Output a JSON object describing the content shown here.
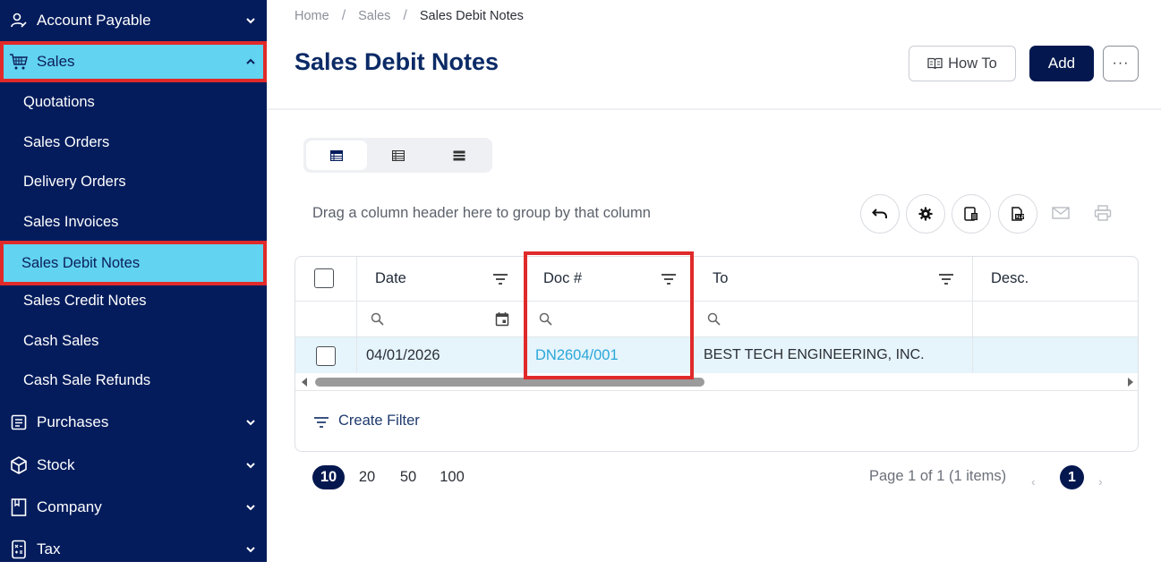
{
  "sidebar": {
    "groups": [
      {
        "label": "Account Payable",
        "icon": "user-edit-icon"
      },
      {
        "label": "Sales",
        "icon": "cart-icon"
      },
      {
        "label": "Purchases",
        "icon": "clipboard-icon"
      },
      {
        "label": "Stock",
        "icon": "cube-icon"
      },
      {
        "label": "Company",
        "icon": "bookmark-icon"
      },
      {
        "label": "Tax",
        "icon": "calculator-icon"
      }
    ],
    "sales_items": [
      {
        "label": "Quotations"
      },
      {
        "label": "Sales Orders"
      },
      {
        "label": "Delivery Orders"
      },
      {
        "label": "Sales Invoices"
      },
      {
        "label": "Sales Debit Notes"
      },
      {
        "label": "Sales Credit Notes"
      },
      {
        "label": "Cash Sales"
      },
      {
        "label": "Cash Sale Refunds"
      }
    ]
  },
  "breadcrumb": [
    "Home",
    "Sales",
    "Sales Debit Notes"
  ],
  "page": {
    "title": "Sales Debit Notes",
    "howto_label": "How To",
    "add_label": "Add",
    "more_label": "···"
  },
  "toolbar": {
    "group_hint": "Drag a column header here to group by that column",
    "icons": [
      "undo-icon",
      "settings-icon",
      "column-chooser-icon",
      "export-icon",
      "email-icon",
      "print-icon"
    ]
  },
  "grid": {
    "columns": [
      "Date",
      "Doc #",
      "To",
      "Desc."
    ],
    "rows": [
      {
        "date": "04/01/2026",
        "doc": "DN2604/001",
        "to": "BEST TECH ENGINEERING, INC.",
        "desc": ""
      }
    ],
    "create_filter_label": "Create Filter"
  },
  "pager": {
    "sizes": [
      "10",
      "20",
      "50",
      "100"
    ],
    "selected_size": "10",
    "info": "Page 1 of 1 (1 items)",
    "current_page": "1"
  },
  "colors": {
    "sidebar_bg": "#041c5c",
    "active_bg": "#62d3f1",
    "highlight": "#e02a2a",
    "primary": "#04184f",
    "link": "#2aa7d9"
  }
}
